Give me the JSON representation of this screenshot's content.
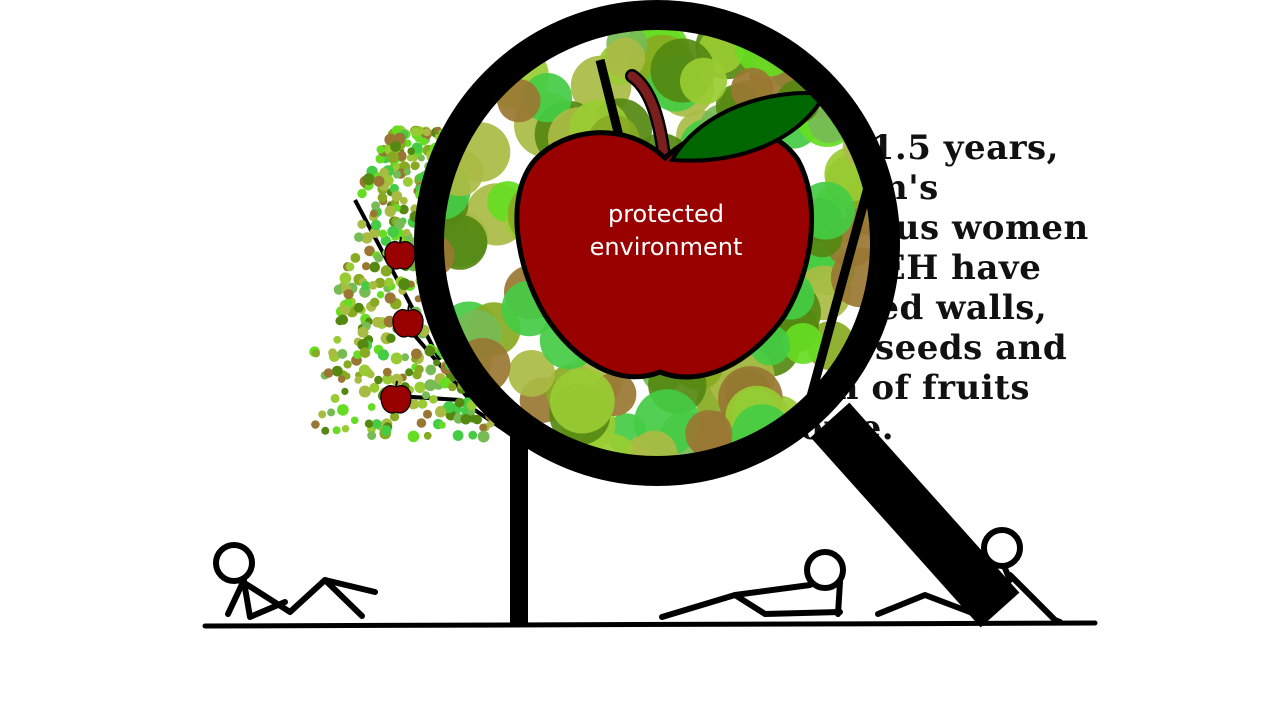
{
  "story": {
    "lines": [
      "ast 1.5 years,",
      "egion's",
      "genous women",
      "SYDEH have",
      "antled walls,",
      "ted seeds and",
      "am of fruits",
      "ome."
    ]
  },
  "magnifier": {
    "label_lines": [
      "protected",
      "environment"
    ]
  },
  "colors": {
    "apple_red": "#990000",
    "leaf_green": "#006600",
    "stem_brown": "#7a1e1e",
    "outline": "#000000",
    "foliage": [
      "#66dd22",
      "#99cc33",
      "#558811",
      "#aabb44",
      "#88aa22",
      "#44cc44",
      "#997733",
      "#77bb55"
    ]
  },
  "icons": {
    "magnifier": "magnifying-glass-icon",
    "apple": "apple-icon",
    "figures": "stick-figure-icon"
  }
}
